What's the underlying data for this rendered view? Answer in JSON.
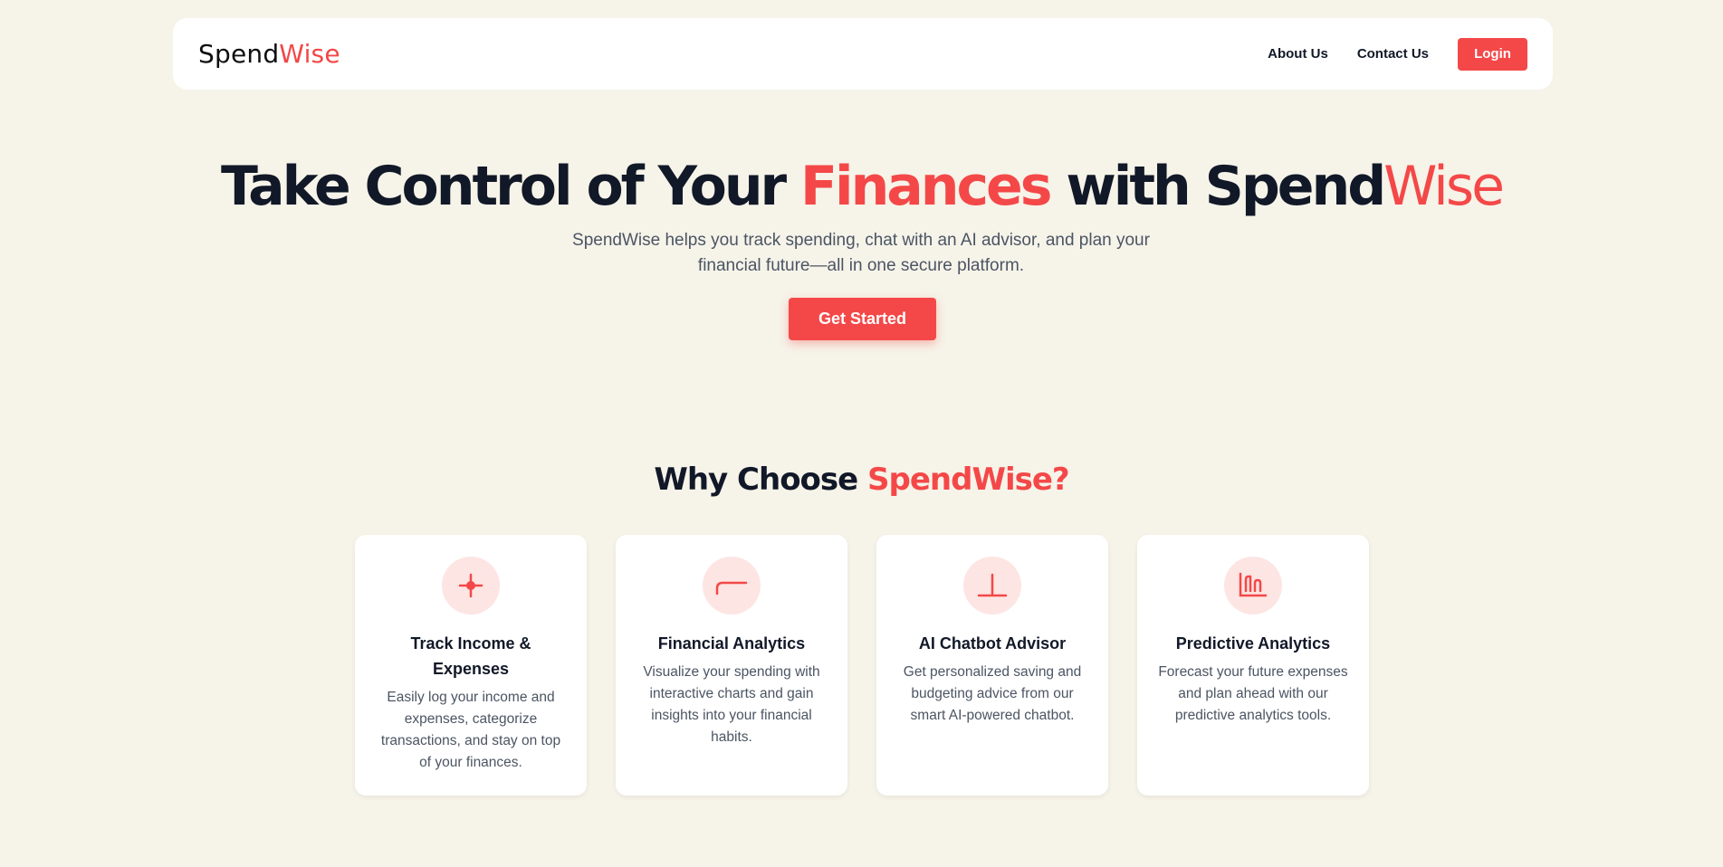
{
  "navbar": {
    "logo_main": "Spend",
    "logo_accent": "Wise",
    "links": [
      "About Us",
      "Contact Us"
    ],
    "login_label": "Login"
  },
  "hero": {
    "title_part1": "Take Control of Your ",
    "title_accent": "Finances",
    "title_part2": " with Spend",
    "title_thin": "Wise",
    "subtitle": "SpendWise helps you track spending, chat with an AI advisor, and plan your financial future—all in one secure platform.",
    "cta_label": "Get Started"
  },
  "features": {
    "title_part1": "Why Choose ",
    "title_accent": "SpendWise?",
    "cards": [
      {
        "icon": "target-icon",
        "title": "Track Income & Expenses",
        "text": "Easily log your income and expenses, categorize transactions, and stay on top of your finances."
      },
      {
        "icon": "chart-line-icon",
        "title": "Financial Analytics",
        "text": "Visualize your spending with interactive charts and gain insights into your financial habits."
      },
      {
        "icon": "chatbot-icon",
        "title": "AI Chatbot Advisor",
        "text": "Get personalized saving and budgeting advice from our smart AI-powered chatbot."
      },
      {
        "icon": "bar-chart-icon",
        "title": "Predictive Analytics",
        "text": "Forecast your future expenses and plan ahead with our predictive analytics tools."
      }
    ]
  },
  "colors": {
    "accent": "#f44848",
    "background": "#f6f3e9",
    "icon_bg": "#fde5e3",
    "text_dark": "#111827"
  }
}
